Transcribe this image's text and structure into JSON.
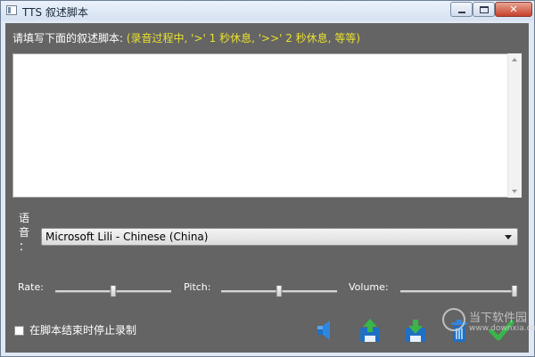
{
  "window": {
    "title": "TTS 叙述脚本",
    "close_glyph": "✕"
  },
  "prompt": {
    "text": "请填写下面的叙述脚本: ",
    "hint": "(录音过程中, '>' 1 秒休息, '>>' 2 秒休息, 等等)"
  },
  "script_text": "",
  "voice": {
    "label_chars": [
      "语",
      "音",
      "："
    ],
    "selected": "Microsoft Lili - Chinese (China)"
  },
  "sliders": {
    "rate": {
      "label": "Rate:",
      "value": 0.5
    },
    "pitch": {
      "label": "Pitch:",
      "value": 0.5
    },
    "volume": {
      "label": "Volume:",
      "value": 1.0
    }
  },
  "stop_recording": {
    "label": "在脚本结束时停止录制",
    "checked": false
  },
  "toolbar": [
    "speaker-icon",
    "upload-save-icon",
    "download-save-icon",
    "trash-icon",
    "checkmark-icon"
  ],
  "watermark": {
    "name": "当下软件园",
    "domain": "www.downxia.com"
  },
  "colors": {
    "hint": "#e8e030",
    "client_bg": "#646464",
    "accent_blue": "#2f7fd0",
    "accent_green": "#39b54a"
  }
}
